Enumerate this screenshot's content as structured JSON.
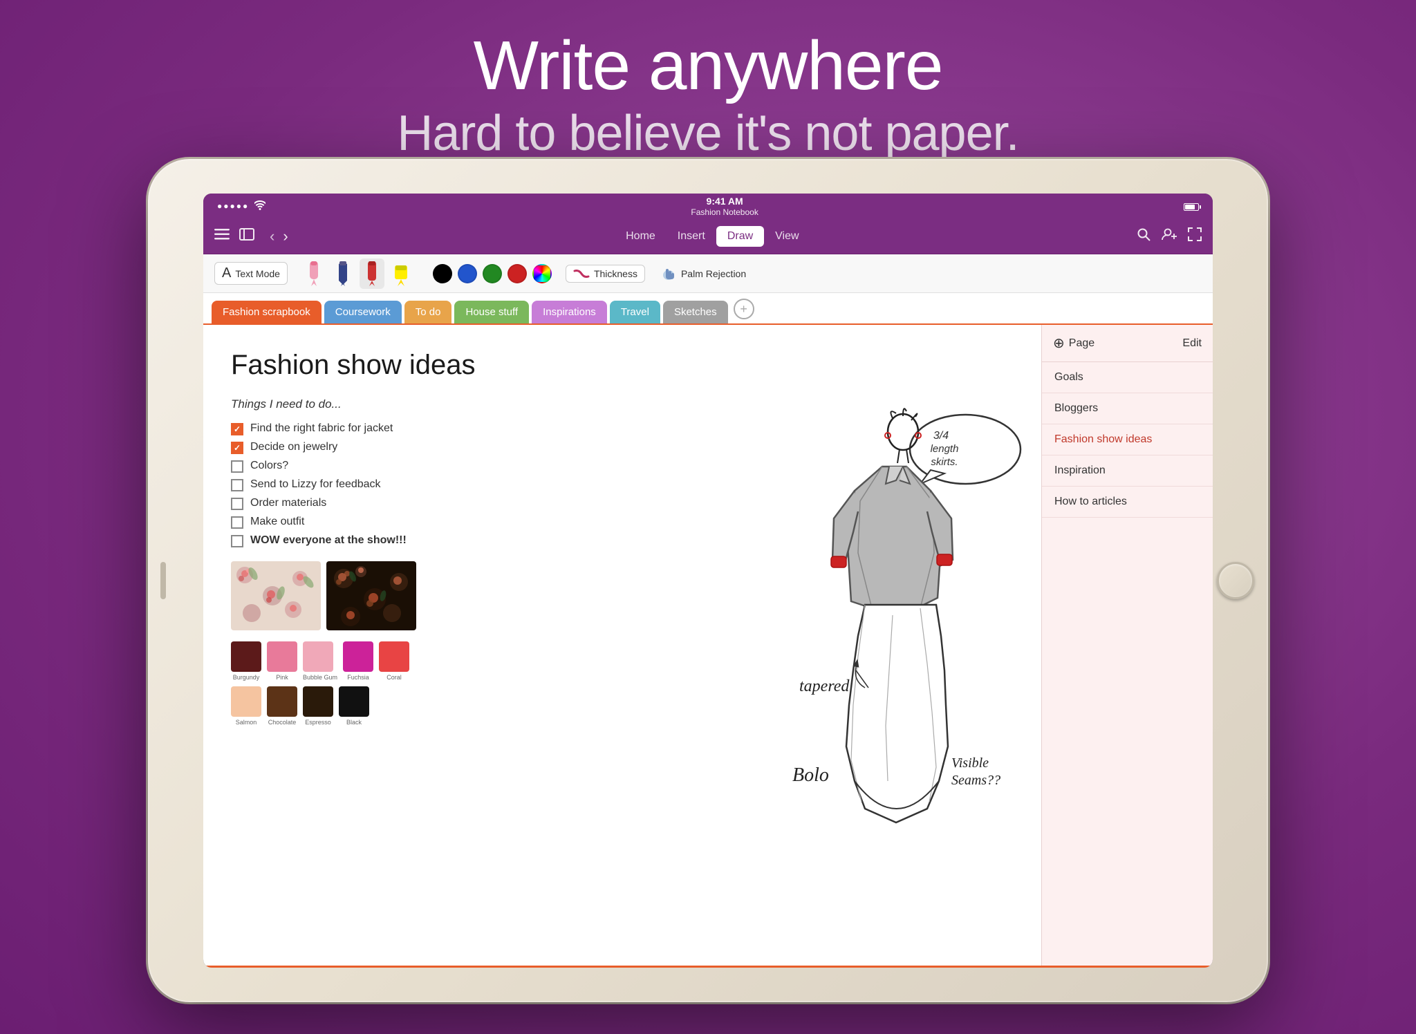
{
  "hero": {
    "title": "Write anywhere",
    "subtitle": "Hard to believe it's not paper."
  },
  "status_bar": {
    "signal_dots": "●●●●●",
    "wifi": "WiFi",
    "time": "9:41 AM",
    "notebook_name": "Fashion Notebook",
    "battery": "100%"
  },
  "toolbar": {
    "menu_items": [
      "Home",
      "Insert",
      "Draw",
      "View"
    ],
    "active_menu": "Draw"
  },
  "draw_toolbar": {
    "text_mode_label": "Text Mode",
    "thickness_label": "Thickness",
    "palm_rejection_label": "Palm Rejection",
    "colors": [
      "#000000",
      "#2255CC",
      "#228822",
      "#CC2222"
    ]
  },
  "tabs": [
    {
      "label": "Fashion scrapbook",
      "color": "#e85d2a",
      "active": true
    },
    {
      "label": "Coursework",
      "color": "#5b9bd5"
    },
    {
      "label": "To do",
      "color": "#e8a44a"
    },
    {
      "label": "House stuff",
      "color": "#7bb85c"
    },
    {
      "label": "Inspirations",
      "color": "#c77dd7"
    },
    {
      "label": "Travel",
      "color": "#5bb8c8"
    },
    {
      "label": "Sketches",
      "color": "#a0a0a0"
    }
  ],
  "page": {
    "title": "Fashion show ideas",
    "intro": "Things I need to do...",
    "todos": [
      {
        "text": "Find the right fabric for jacket",
        "checked": true
      },
      {
        "text": "Decide on jewelry",
        "checked": true
      },
      {
        "text": "Colors?",
        "checked": false
      },
      {
        "text": "Send to Lizzy for feedback",
        "checked": false
      },
      {
        "text": "Order materials",
        "checked": false
      },
      {
        "text": "Make outfit",
        "checked": false
      },
      {
        "text": "WOW everyone at the show!!!",
        "checked": false,
        "bold": true
      }
    ],
    "swatches_row1": [
      {
        "color": "#5C1A1A",
        "label": "Burgundy"
      },
      {
        "color": "#E87A9A",
        "label": "Pink"
      },
      {
        "color": "#F0A8B8",
        "label": "Bubble Gum"
      },
      {
        "color": "#CC2299",
        "label": "Fuchsia"
      },
      {
        "color": "#E84444",
        "label": "Coral"
      }
    ],
    "swatches_row2": [
      {
        "color": "#F5C4A0",
        "label": "Salmon"
      },
      {
        "color": "#5C3317",
        "label": "Chocolate"
      },
      {
        "color": "#2A1A0A",
        "label": "Espresso"
      },
      {
        "color": "#111111",
        "label": "Black"
      }
    ]
  },
  "sidebar": {
    "add_label": "Page",
    "edit_label": "Edit",
    "items": [
      {
        "label": "Goals",
        "active": false
      },
      {
        "label": "Bloggers",
        "active": false
      },
      {
        "label": "Fashion show ideas",
        "active": true
      },
      {
        "label": "Inspiration",
        "active": false
      },
      {
        "label": "How to articles",
        "active": false
      }
    ]
  }
}
